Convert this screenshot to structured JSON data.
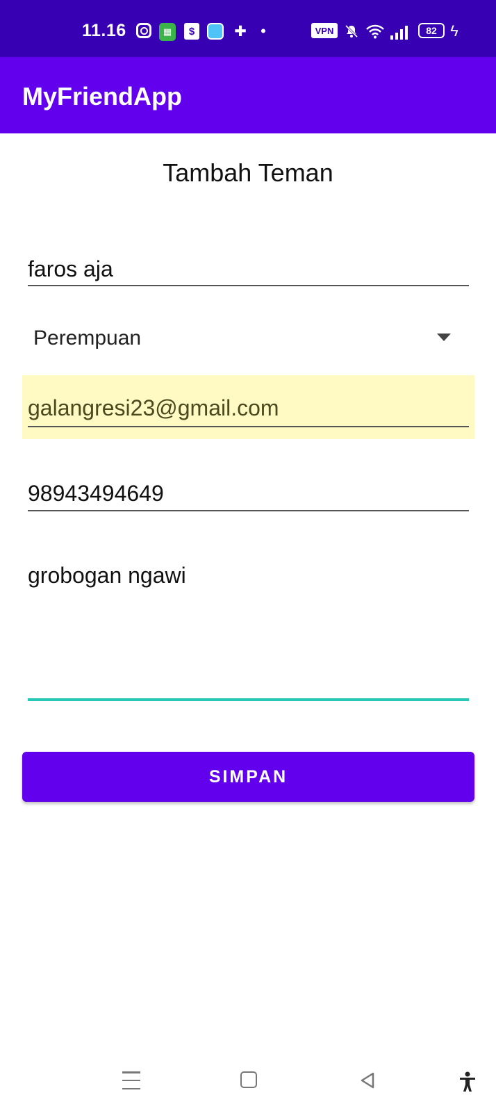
{
  "status_bar": {
    "time": "11.16",
    "vpn_label": "VPN",
    "battery": "82",
    "icons": [
      "instagram-icon",
      "green-app-icon",
      "shopping-bag-icon",
      "blue-app-icon",
      "gamepad-icon",
      "dot-icon",
      "vpn-icon",
      "bell-off-icon",
      "wifi-icon",
      "signal-icon",
      "battery-icon",
      "charging-bolt-icon"
    ]
  },
  "app_bar": {
    "title": "MyFriendApp"
  },
  "form": {
    "heading": "Tambah Teman",
    "name_value": "faros aja",
    "gender_value": "Perempuan",
    "email_value": "galangresi23@gmail.com",
    "phone_value": "98943494649",
    "address_value": "grobogan ngawi",
    "save_label": "SIMPAN"
  },
  "nav_bar": {
    "icons": [
      "menu-icon",
      "home-icon",
      "back-icon",
      "accessibility-icon"
    ]
  },
  "colors": {
    "status_bar": "#3700b3",
    "app_bar": "#6200ee",
    "button": "#6200ee",
    "autofill_highlight": "#fff9c4",
    "focused_underline": "#26c6b9"
  }
}
